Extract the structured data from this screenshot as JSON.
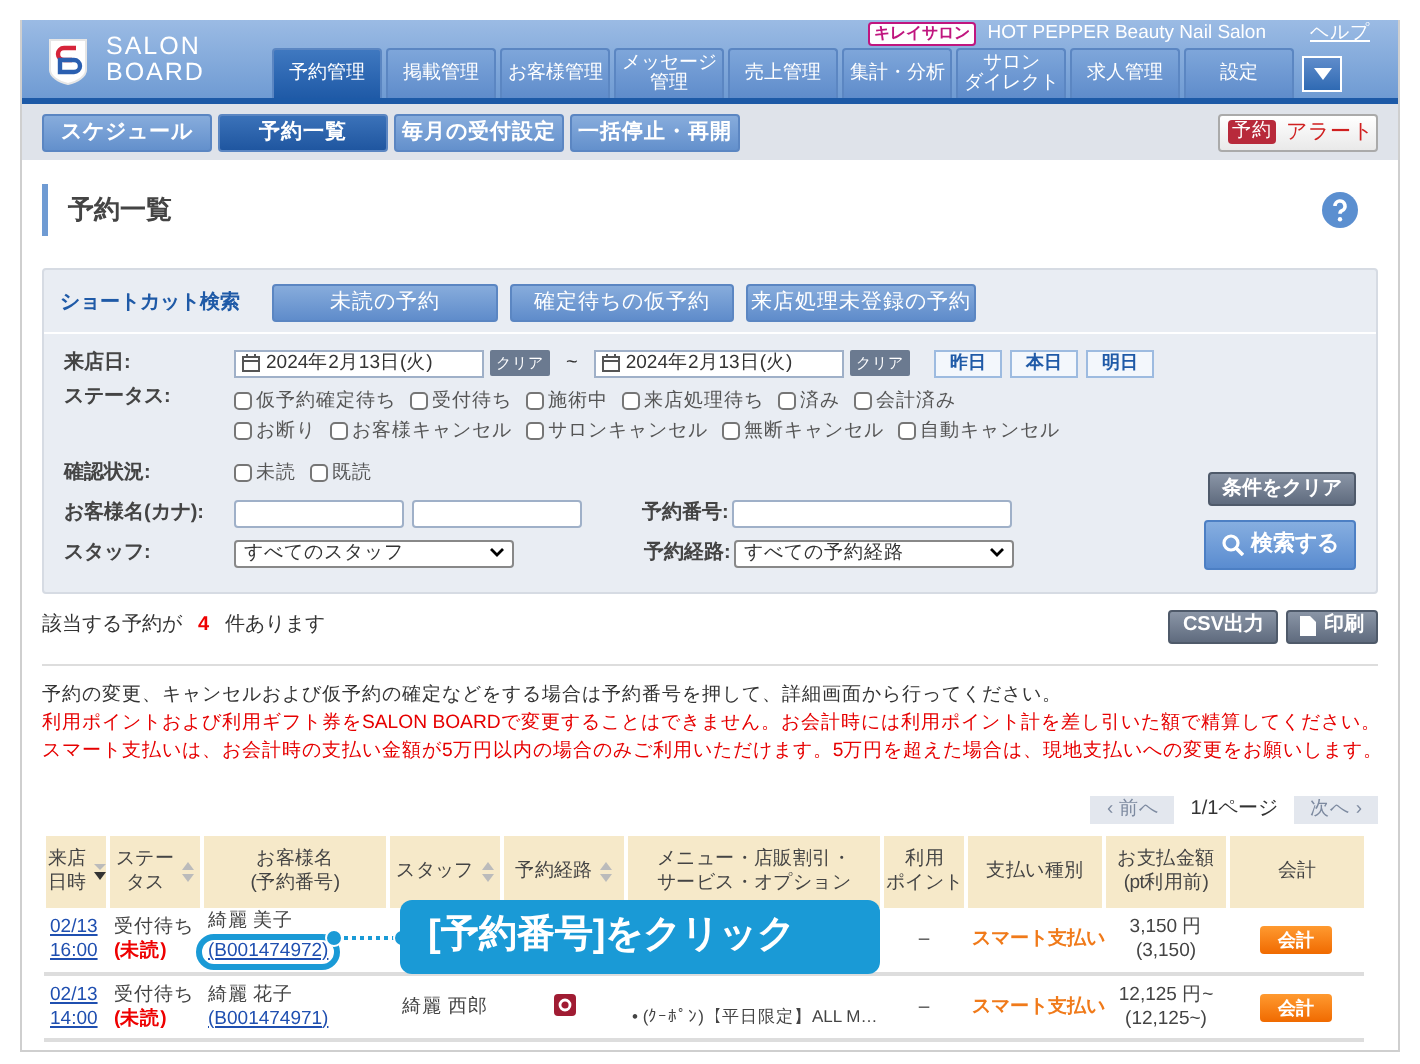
{
  "header": {
    "logo_lines": [
      "SALON",
      "BOARD"
    ],
    "brand_badge": "キレイサロン",
    "salon_name": "HOT PEPPER Beauty Nail Salon",
    "help_link": "ヘルプ"
  },
  "main_tabs": [
    {
      "label": "予約管理",
      "selected": true
    },
    {
      "label": "掲載管理",
      "selected": false
    },
    {
      "label": "お客様管理",
      "selected": false
    },
    {
      "lines": [
        "メッセージ",
        "管理"
      ],
      "selected": false
    },
    {
      "label": "売上管理",
      "selected": false
    },
    {
      "label": "集計・分析",
      "selected": false
    },
    {
      "lines": [
        "サロン",
        "ダイレクト"
      ],
      "selected": false
    },
    {
      "label": "求人管理",
      "selected": false
    },
    {
      "label": "設定",
      "selected": false
    }
  ],
  "sub_tabs": [
    {
      "label": "スケジュール",
      "selected": false
    },
    {
      "label": "予約一覧",
      "selected": true
    },
    {
      "label": "毎月の受付設定",
      "selected": false
    },
    {
      "label": "一括停止・再開",
      "selected": false
    }
  ],
  "alert_button": {
    "badge": "予約",
    "label": "アラート"
  },
  "page_title": "予約一覧",
  "search": {
    "shortcut_label": "ショートカット検索",
    "shortcut_buttons": [
      "未読の予約",
      "確定待ちの仮予約",
      "来店処理未登録の予約"
    ],
    "date": {
      "label": "来店日:",
      "from": "2024年2月13日(火)",
      "from_clear": "クリア",
      "separator": "~",
      "to": "2024年2月13日(火)",
      "to_clear": "クリア",
      "quick_buttons": [
        "昨日",
        "本日",
        "明日"
      ]
    },
    "status": {
      "label": "ステータス:",
      "option_rows": [
        [
          {
            "label": "仮予約確定待ち",
            "checked": false
          },
          {
            "label": "受付待ち",
            "checked": false
          },
          {
            "label": "施術中",
            "checked": false
          },
          {
            "label": "来店処理待ち",
            "checked": false
          },
          {
            "label": "済み",
            "checked": false
          },
          {
            "label": "会計済み",
            "checked": false
          }
        ],
        [
          {
            "label": "お断り",
            "checked": false
          },
          {
            "label": "お客様キャンセル",
            "checked": false
          },
          {
            "label": "サロンキャンセル",
            "checked": false
          },
          {
            "label": "無断キャンセル",
            "checked": false
          },
          {
            "label": "自動キャンセル",
            "checked": false
          }
        ]
      ]
    },
    "confirm": {
      "label": "確認状況:",
      "options": [
        {
          "label": "未読",
          "checked": false
        },
        {
          "label": "既読",
          "checked": false
        }
      ]
    },
    "customer_name": {
      "label": "お客様名(カナ):"
    },
    "reservation_no": {
      "label": "予約番号:"
    },
    "staff": {
      "label": "スタッフ:",
      "value": "すべてのスタッフ"
    },
    "route": {
      "label": "予約経路:",
      "value": "すべての予約経路"
    },
    "clear_button": "条件をクリア",
    "search_button": "検索する"
  },
  "result": {
    "prefix": "該当する予約が",
    "count": "4",
    "suffix": "件あります"
  },
  "export_buttons": [
    {
      "label": "CSV出力",
      "kind": "plain"
    },
    {
      "label": "印刷",
      "kind": "print"
    }
  ],
  "notices": [
    {
      "kind": "info",
      "text": "予約の変更、キャンセルおよび仮予約の確定などをする場合は予約番号を押して、詳細画面から行ってください。"
    },
    {
      "kind": "warning",
      "text": "利用ポイントおよび利用ギフト券をSALON BOARDで変更することはできません。お会計時には利用ポイント計を差し引いた額で精算してください。"
    },
    {
      "kind": "warning",
      "text": "スマート支払いは、お会計時の支払い金額が5万円以内の場合のみご利用いただけます。5万円を超えた場合は、現地支払いへの変更をお願いします。"
    }
  ],
  "pagination": {
    "prev": "‹ 前へ",
    "prev_disabled": true,
    "page": "1/1ページ",
    "next": "次へ ›",
    "next_disabled": true
  },
  "table": {
    "columns": [
      {
        "lines": [
          "来店",
          "日時"
        ],
        "sortable": true,
        "sorted_desc": true
      },
      {
        "lines": [
          "ステー",
          "タス"
        ],
        "sortable": true,
        "sorted_desc": false
      },
      {
        "lines": [
          "お客様名",
          "(予約番号)"
        ]
      },
      {
        "lines": [
          "スタッフ"
        ],
        "sortable": true,
        "sorted_desc": false
      },
      {
        "lines": [
          "予約経路"
        ],
        "sortable": true,
        "sorted_desc": false
      },
      {
        "lines": [
          "メニュー・店販割引・",
          "サービス・オプション"
        ]
      },
      {
        "lines": [
          "利用",
          "ポイント"
        ]
      },
      {
        "lines": [
          "支払い種別"
        ]
      },
      {
        "lines": [
          "お支払金額",
          "(pt利用前)"
        ]
      },
      {
        "lines": [
          "会計"
        ]
      }
    ],
    "rows": [
      {
        "date": "02/13",
        "time": "16:00",
        "status": "受付待ち",
        "read_state": "(未読)",
        "customer": "綺麗 美子",
        "reservation_no": "(B001474972)",
        "highlighted": true,
        "route_icon": false,
        "points": "–",
        "payment": "スマート支払い",
        "amount": "3,150 円",
        "amount_before": "(3,150)",
        "checkout": "会計"
      },
      {
        "date": "02/13",
        "time": "14:00",
        "status": "受付待ち",
        "read_state": "(未読)",
        "customer": "綺麗 花子",
        "reservation_no": "(B001474971)",
        "highlighted": false,
        "staff": "綺麗 西郎",
        "route_icon": true,
        "menu": "• (ｸｰﾎﾟﾝ)【平日限定】ALL M…",
        "points": "–",
        "payment": "スマート支払い",
        "amount": "12,125 円~",
        "amount_before": "(12,125~)",
        "checkout": "会計"
      }
    ]
  },
  "callout": {
    "text": "[予約番号]をクリック"
  }
}
